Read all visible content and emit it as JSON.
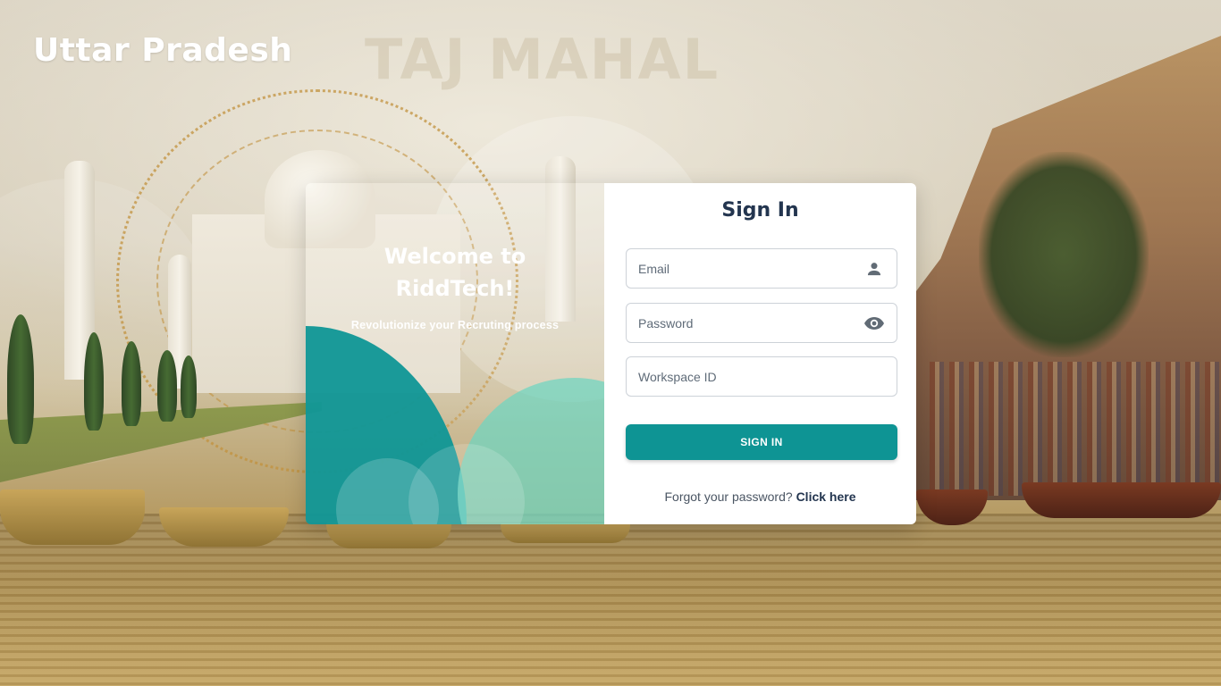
{
  "background": {
    "region_title": "Uttar Pradesh",
    "watermark": "TAJ MAHAL"
  },
  "promo": {
    "welcome": "Welcome to RiddTech!",
    "tagline": "Revolutionize your Recruting process"
  },
  "form": {
    "title": "Sign In",
    "email": {
      "placeholder": "Email",
      "value": "",
      "icon": "person-icon"
    },
    "password": {
      "placeholder": "Password",
      "value": "",
      "icon": "eye-icon"
    },
    "workspace": {
      "placeholder": "Workspace ID",
      "value": ""
    },
    "submit_label": "SIGN IN",
    "forgot_text": "Forgot your password?",
    "forgot_link": "Click here"
  },
  "colors": {
    "accent": "#0e9494",
    "title_text": "#23354f",
    "promo_teal": "#0f9696",
    "promo_mint": "#6ed6c0"
  }
}
